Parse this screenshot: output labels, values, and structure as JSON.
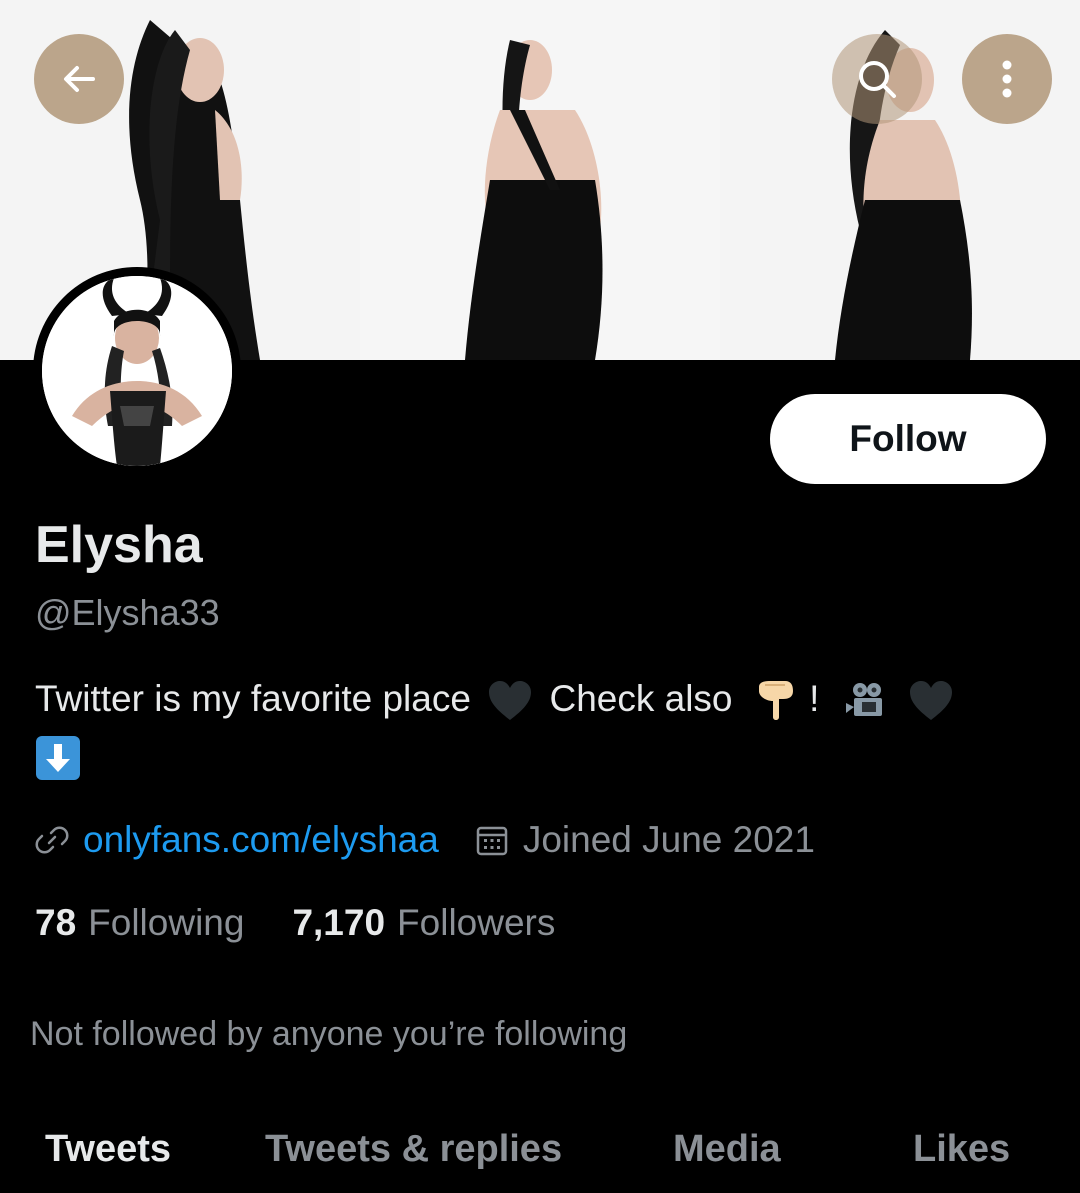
{
  "profile": {
    "name": "Elysha",
    "handle": "@Elysha33",
    "bio_part1": "Twitter is my favorite place",
    "bio_part2": "Check also",
    "bio_part3": "!",
    "website": "onlyfans.com/elyshaa",
    "joined": "Joined June 2021",
    "following_count": "78",
    "following_label": "Following",
    "followers_count": "7,170",
    "followers_label": "Followers",
    "not_followed": "Not followed by anyone you’re following"
  },
  "actions": {
    "follow_label": "Follow"
  },
  "tabs": [
    {
      "label": "Tweets"
    },
    {
      "label": "Tweets & replies"
    },
    {
      "label": "Media"
    },
    {
      "label": "Likes"
    }
  ],
  "icons": {
    "back": "arrow-left-icon",
    "search": "search-icon",
    "more": "more-vertical-icon",
    "link": "link-icon",
    "calendar": "calendar-icon"
  },
  "colors": {
    "background": "#000000",
    "text": "#e7e9ea",
    "secondary": "#8b9096",
    "link": "#1d9bf0",
    "overlay_button": "#b09678"
  }
}
